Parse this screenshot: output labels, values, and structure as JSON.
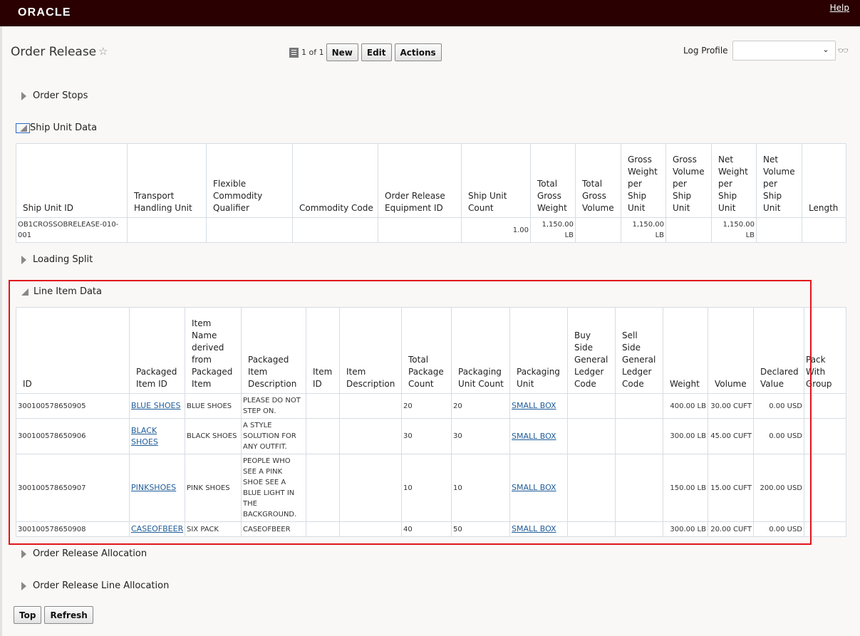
{
  "header": {
    "logo": "ORACLE",
    "help": "Help"
  },
  "page": {
    "title": "Order Release",
    "record_count": "1 of 1",
    "buttons": {
      "new": "New",
      "edit": "Edit",
      "actions": "Actions"
    },
    "log_profile_label": "Log Profile",
    "log_profile_value": ""
  },
  "sections": {
    "order_stops": "Order Stops",
    "ship_unit_data": "Ship Unit Data",
    "loading_split": "Loading Split",
    "line_item_data": "Line Item Data",
    "order_release_allocation": "Order Release Allocation",
    "order_release_line_allocation": "Order Release Line Allocation"
  },
  "ship_unit_table": {
    "columns": [
      "Ship Unit ID",
      "Transport Handling Unit",
      "Flexible Commodity Qualifier",
      "Commodity Code",
      "Order Release Equipment ID",
      "Ship Unit Count",
      "Total Gross Weight",
      "Total Gross Volume",
      "Gross Weight per Ship Unit",
      "Gross Volume per Ship Unit",
      "Net Weight per Ship Unit",
      "Net Volume per Ship Unit",
      "Length"
    ],
    "rows": [
      [
        "OB1CROSSOBRELEASE-010-001",
        "",
        "",
        "",
        "",
        "1.00",
        "1,150.00 LB",
        "",
        "1,150.00 LB",
        "",
        "1,150.00 LB",
        "",
        ""
      ]
    ]
  },
  "line_item_table": {
    "columns": [
      "ID",
      "Packaged Item ID",
      "Item Name derived from Packaged Item",
      "Packaged Item Description",
      "Item ID",
      "Item Description",
      "Total Package Count",
      "Packaging Unit Count",
      "Packaging Unit",
      "Buy Side General Ledger Code",
      "Sell Side General Ledger Code",
      "Weight",
      "Volume",
      "Declared Value",
      "Pack With Group"
    ],
    "rows": [
      [
        "300100578650905",
        "BLUE SHOES",
        "BLUE SHOES",
        "PLEASE DO NOT STEP ON.",
        "",
        "",
        "20",
        "20",
        "SMALL BOX",
        "",
        "",
        "400.00 LB",
        "30.00 CUFT",
        "0.00 USD",
        ""
      ],
      [
        "300100578650906",
        "BLACK SHOES",
        "BLACK SHOES",
        "A STYLE SOLUTION FOR ANY OUTFIT.",
        "",
        "",
        "30",
        "30",
        "SMALL BOX",
        "",
        "",
        "300.00 LB",
        "45.00 CUFT",
        "0.00 USD",
        ""
      ],
      [
        "300100578650907",
        "PINKSHOES",
        "PINK SHOES",
        "PEOPLE WHO SEE A PINK SHOE SEE A BLUE LIGHT IN THE BACKGROUND.",
        "",
        "",
        "10",
        "10",
        "SMALL BOX",
        "",
        "",
        "150.00 LB",
        "15.00 CUFT",
        "200.00 USD",
        ""
      ],
      [
        "300100578650908",
        "CASEOFBEER",
        "SIX PACK",
        "CASEOFBEER",
        "",
        "",
        "40",
        "50",
        "SMALL BOX",
        "",
        "",
        "300.00 LB",
        "20.00 CUFT",
        "0.00 USD",
        ""
      ]
    ]
  },
  "footer": {
    "top": "Top",
    "refresh": "Refresh"
  },
  "colors": {
    "header_bg": "#2a0000",
    "highlight_box": "#e1141c",
    "link": "#1f5c99"
  }
}
